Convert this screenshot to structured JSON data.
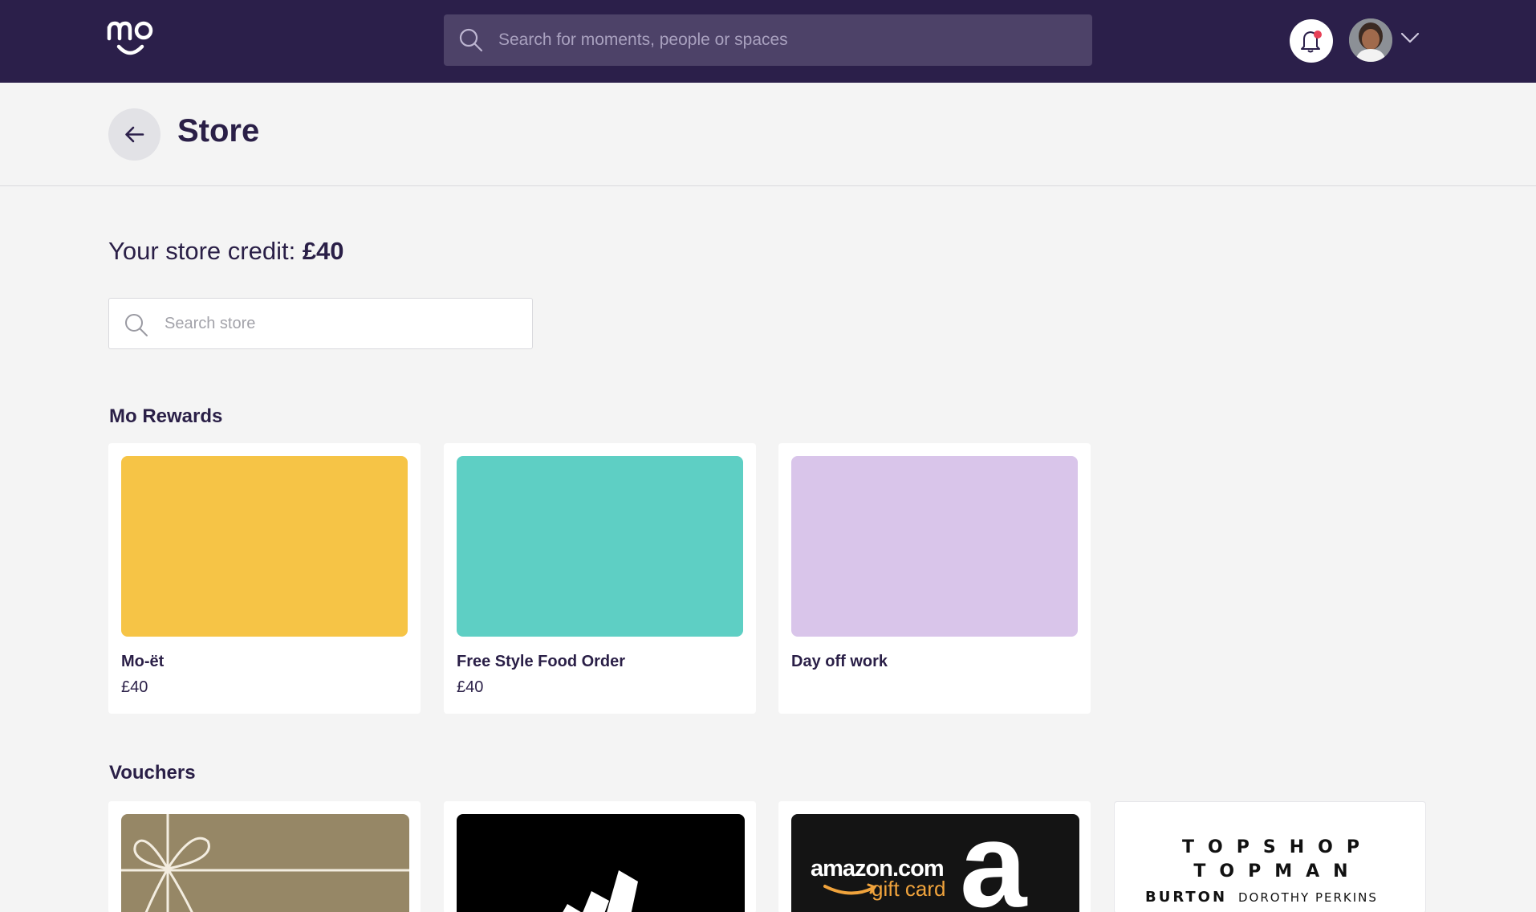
{
  "header": {
    "logo_text": "mo",
    "search_placeholder": "Search for moments, people or spaces"
  },
  "page": {
    "title": "Store",
    "credit_label": "Your store credit: ",
    "credit_value": "£40",
    "search_placeholder": "Search store"
  },
  "sections": {
    "rewards_title": "Mo Rewards",
    "vouchers_title": "Vouchers"
  },
  "rewards": [
    {
      "name": "Mo-ët",
      "price": "£40",
      "color": "#f6c446"
    },
    {
      "name": "Free Style Food Order",
      "price": "£40",
      "color": "#5ecfc4"
    },
    {
      "name": "Day off work",
      "price": "",
      "color": "#d9c5ea"
    }
  ],
  "vouchers": [
    {
      "brand": "gift-card",
      "color": "#968766"
    },
    {
      "brand": "adidas",
      "color": "#000000"
    },
    {
      "brand": "amazon",
      "color": "#141414",
      "wordmark": "amazon.com",
      "sub": "gift card",
      "letter": "a"
    },
    {
      "brand": "topshop",
      "color": "#ffffff",
      "lines": [
        "TOPSHOP",
        "TOPMAN",
        "BURTON",
        "DOROTHY PERKINS"
      ]
    }
  ],
  "colors": {
    "nav_bg": "#2b1f4a",
    "page_bg": "#f4f4f4",
    "notification_dot": "#e84057"
  }
}
